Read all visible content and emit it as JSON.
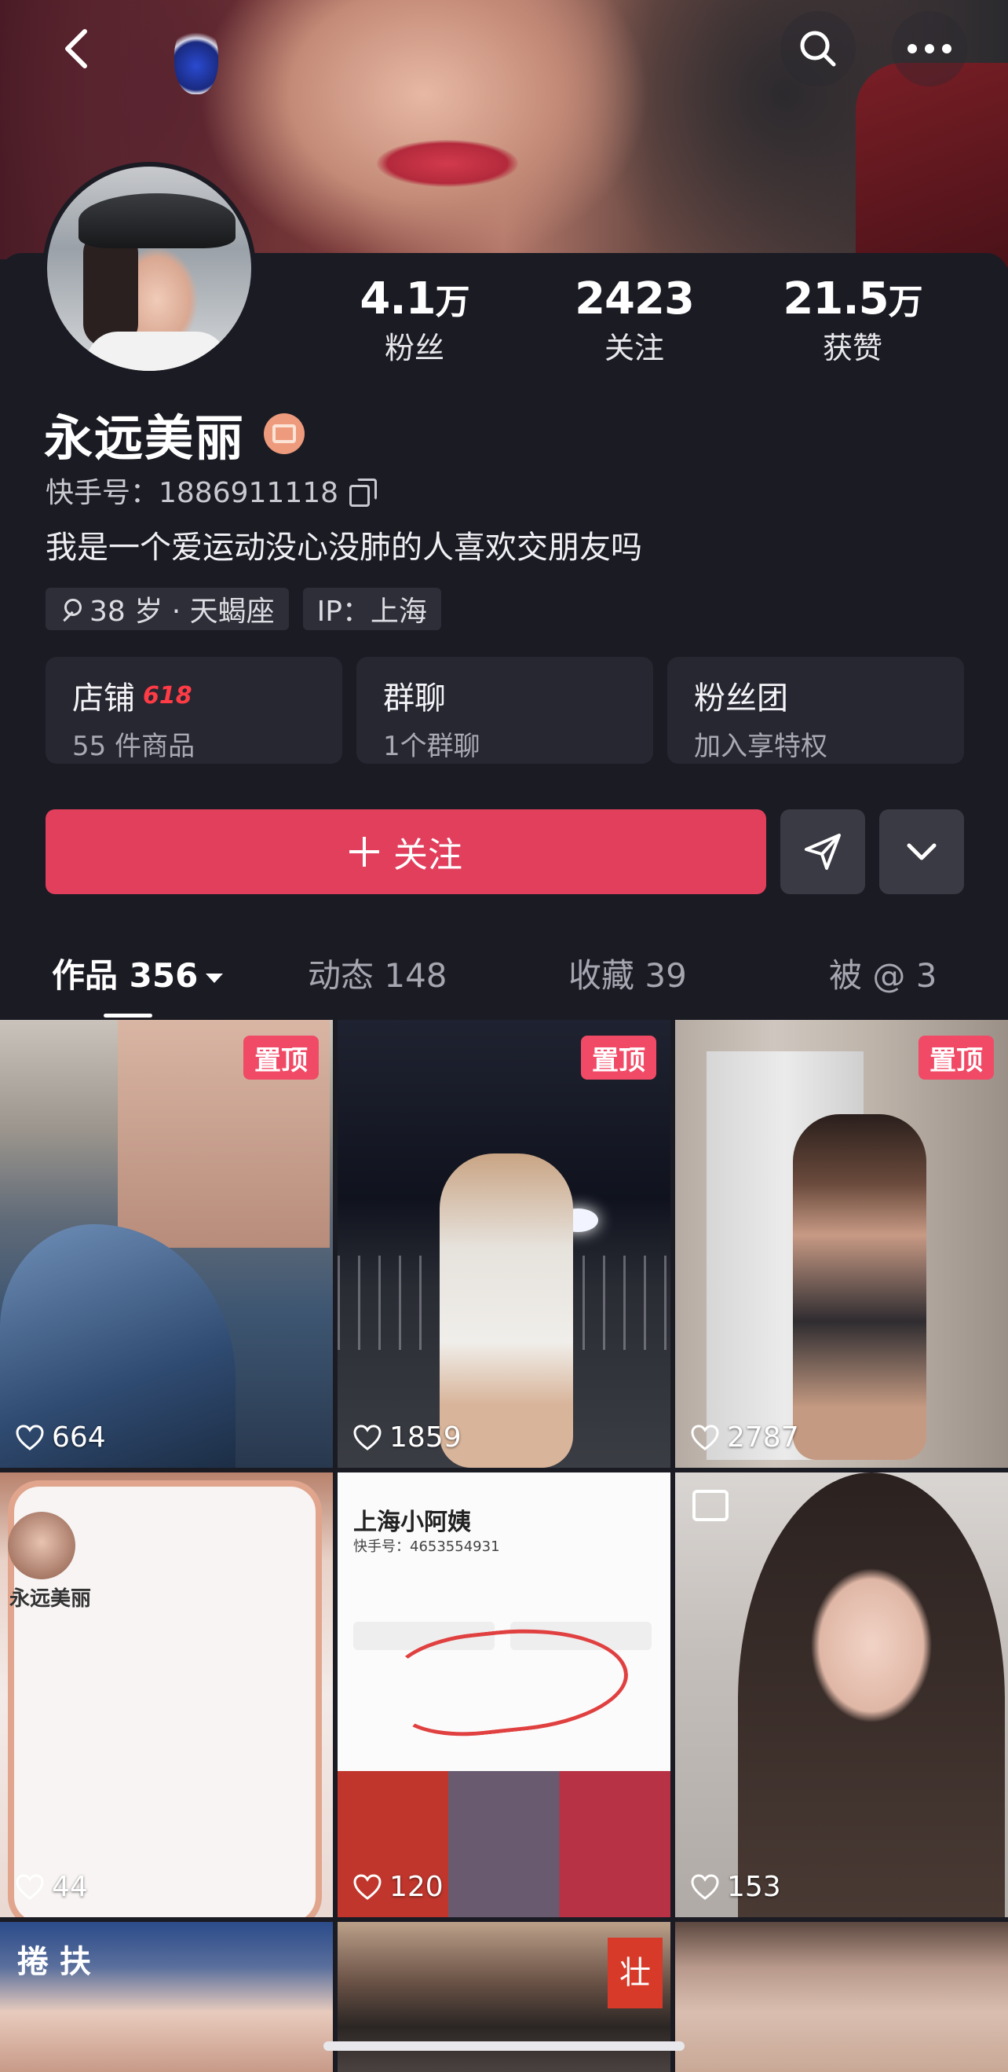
{
  "profile": {
    "name": "永远美丽",
    "kuaishou_id": "快手号：1886911118",
    "bio": "我是一个爱运动没心没肺的人喜欢交朋友吗",
    "tags": [
      "38 岁 · 天蝎座",
      "IP：上海"
    ]
  },
  "stats": [
    {
      "num": "4.1",
      "unit": "万",
      "label": "粉丝"
    },
    {
      "num": "2423",
      "unit": "",
      "label": "关注"
    },
    {
      "num": "21.5",
      "unit": "万",
      "label": "获赞"
    }
  ],
  "cards": [
    {
      "title": "店铺",
      "hot": "618",
      "subtitle": "55 件商品"
    },
    {
      "title": "群聊",
      "hot": "",
      "subtitle": "1个群聊"
    },
    {
      "title": "粉丝团",
      "hot": "",
      "subtitle": "加入享特权"
    }
  ],
  "actions": {
    "follow_label": "关注"
  },
  "tabs": [
    {
      "label": "作品 356"
    },
    {
      "label": "动态 148"
    },
    {
      "label": "收藏 39"
    },
    {
      "label": "被 @ 3"
    }
  ],
  "grid": {
    "pin_label": "置顶",
    "items": [
      {
        "likes": "664",
        "pinned": true
      },
      {
        "likes": "1859",
        "pinned": true
      },
      {
        "likes": "2787",
        "pinned": true
      },
      {
        "likes": "44",
        "pinned": false
      },
      {
        "likes": "120",
        "pinned": false
      },
      {
        "likes": "153",
        "pinned": false
      },
      {
        "likes": "",
        "pinned": false
      },
      {
        "likes": "",
        "pinned": false
      },
      {
        "likes": "",
        "pinned": false
      }
    ],
    "thumb_text": {
      "item4_title": "永远美丽",
      "item5_name": "上海小阿姨",
      "item5_id": "快手号：4653554931",
      "item7_calligraphy": "捲 扶",
      "item8_sign": "壮"
    }
  },
  "colors": {
    "accent": "#e23f5d",
    "pin": "#f04a66",
    "background": "#1b1b24",
    "card": "#272731",
    "hot": "#ff3b45"
  },
  "icons": {
    "back": "chevron-left-icon",
    "search": "search-icon",
    "more": "more-dots-icon",
    "verified": "badge-icon",
    "copy": "copy-icon",
    "gender": "female-icon",
    "send": "send-icon",
    "expand": "chevron-down-icon",
    "like": "heart-icon",
    "gallery": "gallery-icon"
  }
}
